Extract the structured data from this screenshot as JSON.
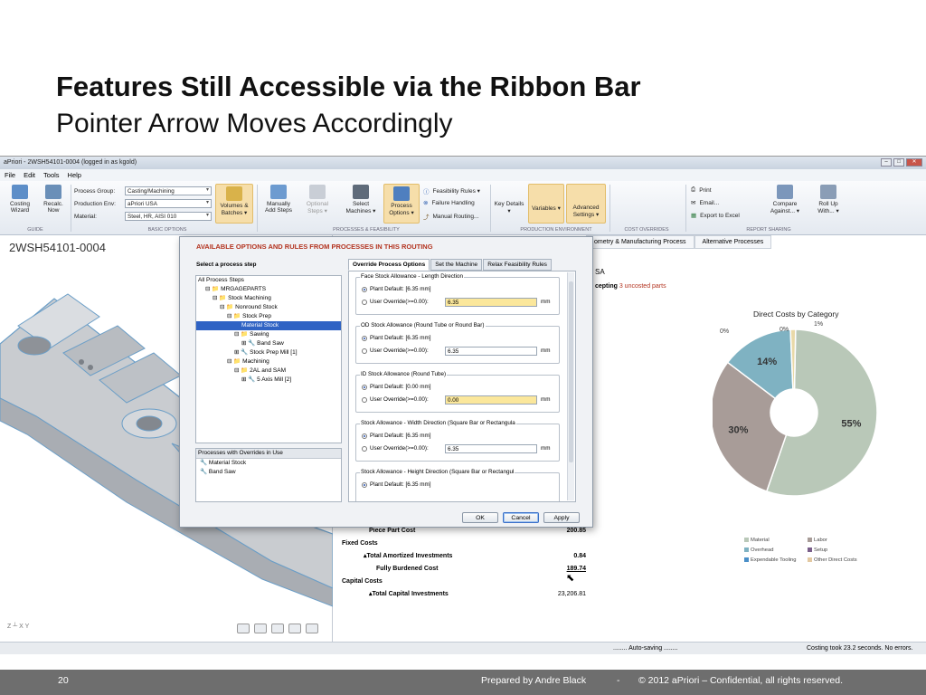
{
  "slide": {
    "title": "Features Still Accessible via the Ribbon Bar",
    "subtitle": "Pointer Arrow Moves Accordingly",
    "page_number": "20",
    "prepared_by": "Prepared by Andre Black",
    "dash": "-",
    "copyright": "© 2012 aPriori – Confidential, all rights reserved."
  },
  "window": {
    "title": "aPriori - 2WSH54101-0004 (logged in as kgold)",
    "menu": [
      "File",
      "Edit",
      "Tools",
      "Help"
    ]
  },
  "ribbon": {
    "costing_wizard": "Costing Wizard",
    "recalc": "Recalc. Now",
    "process_group_label": "Process Group:",
    "process_group_value": "Casting/Machining",
    "production_env_label": "Production Env:",
    "production_env_value": "aPriori USA",
    "material_label": "Material:",
    "material_value": "Steel, HR, AISI 010",
    "volumes_batches": "Volumes & Batches ▾",
    "manually_add_steps": "Manually Add Steps",
    "optional_steps": "Optional Steps ▾",
    "select_machines": "Select Machines ▾",
    "process_options": "Process Options ▾",
    "feasibility_rules": "Feasibility Rules ▾",
    "failure_handling": "Failure Handling",
    "manual_routing": "Manual Routing...",
    "key_details": "Key Details ▾",
    "variables": "Variables ▾",
    "advanced_settings": "Advanced Settings ▾",
    "print": "Print",
    "email": "Email...",
    "export_excel": "Export to Excel",
    "compare_against": "Compare Against... ▾",
    "roll_up_with": "Roll Up With... ▾",
    "groups": {
      "guide": "GUIDE",
      "basic": "BASIC OPTIONS",
      "process_feasibility": "PROCESSES & FEASIBILITY",
      "production_env": "PRODUCTION ENVIRONMENT",
      "cost_overrides": "COST OVERRIDES",
      "report_sharing": "REPORT SHARING"
    }
  },
  "left_pane": {
    "part_id": "2WSH54101-0004",
    "axis_label": "Z ┴ X  Y"
  },
  "right_pane": {
    "tabs": [
      "ometry & Manufacturing Process",
      "Alternative Processes"
    ],
    "sa_fragment": "SA",
    "excepting": "cepting",
    "uncosted": "3 uncosted parts",
    "chart_title": "Direct Costs by Category",
    "costs": [
      {
        "label": "Piece Part Cost",
        "value": "200.85",
        "bold": true
      },
      {
        "label": "Fixed Costs",
        "value": "",
        "bold": true
      },
      {
        "label": "▴Total Amortized Investments",
        "value": "0.84",
        "bold": true
      },
      {
        "label": "Fully Burdened Cost",
        "value": "189.74",
        "bold": true
      },
      {
        "label": "Capital Costs",
        "value": "",
        "bold": true
      },
      {
        "label": "▴Total Capital Investments",
        "value": "23,206.81",
        "bold": true
      }
    ]
  },
  "chart_data": {
    "type": "pie",
    "title": "Direct Costs by Category",
    "slices": [
      {
        "label": "Material",
        "value": 55,
        "color": "#b9c8b8"
      },
      {
        "label": "Labor",
        "value": 30,
        "color": "#a89c98"
      },
      {
        "label": "Overhead",
        "value": 14,
        "color": "#7fb2c2"
      },
      {
        "label": "Setup",
        "value": 1,
        "color": "#e9d9a8"
      },
      {
        "label": "Expendable Tooling",
        "value": 0,
        "color": "#7a5f8a"
      },
      {
        "label": "Other Direct Costs",
        "value": 0,
        "color": "#e3c9a2"
      }
    ],
    "data_labels": [
      "55%",
      "30%",
      "14%",
      "1%",
      "0%",
      "0%"
    ],
    "legend": [
      {
        "label": "Material",
        "color": "#b9c8b8"
      },
      {
        "label": "Labor",
        "color": "#a89c98"
      },
      {
        "label": "Overhead",
        "color": "#7fb2c2"
      },
      {
        "label": "Setup",
        "color": "#7a5f8a"
      },
      {
        "label": "Expendable Tooling",
        "color": "#4a8fc8"
      },
      {
        "label": "Other Direct Costs",
        "color": "#e3c9a2"
      }
    ]
  },
  "dialog": {
    "title": "AVAILABLE OPTIONS AND RULES FROM PROCESSES IN THIS ROUTING",
    "select_step": "Select a process step",
    "tree": [
      {
        "label": "All Process Steps",
        "indent": 0,
        "selected": false
      },
      {
        "label": "⊟ 📁 MRGAGEPARTS",
        "indent": 1,
        "selected": false
      },
      {
        "label": "⊟ 📁 Stock Machining",
        "indent": 2,
        "selected": false
      },
      {
        "label": "⊟ 📁 Nonround Stock",
        "indent": 3,
        "selected": false
      },
      {
        "label": "⊟ 📁 Stock Prep",
        "indent": 4,
        "selected": false
      },
      {
        "label": "Material Stock",
        "indent": 6,
        "selected": true
      },
      {
        "label": "⊟ 📁 Sawing",
        "indent": 5,
        "selected": false
      },
      {
        "label": "⊞ 🔧 Band Saw",
        "indent": 6,
        "selected": false
      },
      {
        "label": "⊞ 🔧 Stock Prep Mill [1]",
        "indent": 5,
        "selected": false
      },
      {
        "label": "⊟ 📁 Machining",
        "indent": 4,
        "selected": false
      },
      {
        "label": "⊟ 📁 2AL and SAM",
        "indent": 5,
        "selected": false
      },
      {
        "label": "⊞ 🔧 5 Axis Mill [2]",
        "indent": 6,
        "selected": false
      }
    ],
    "overrides_header": "Processes with Overrides in Use",
    "overrides": [
      "🔧 Material Stock",
      "🔧 Band Saw"
    ],
    "tabs": [
      "Override Process Options",
      "Set the Machine",
      "Relax Feasibility Rules"
    ],
    "options": [
      {
        "legend": "Face Stock Allowance - Length Direction",
        "default": "Plant Default: [6.35 mm]",
        "override": "User Override(>=0.00):",
        "value": "6.35",
        "highlight": true,
        "unit": "mm"
      },
      {
        "legend": "OD Stock Allowance (Round Tube or Round Bar)",
        "default": "Plant Default: [6.35 mm]",
        "override": "User Override(>=0.00):",
        "value": "6.35",
        "highlight": false,
        "unit": "mm"
      },
      {
        "legend": "ID Stock Allowance (Round Tube)",
        "default": "Plant Default: [0.00 mm]",
        "override": "User Override(>=0.00):",
        "value": "0.00",
        "highlight": true,
        "unit": "mm"
      },
      {
        "legend": "Stock Allowance - Width Direction (Square Bar or Rectangula",
        "default": "Plant Default: [6.35 mm]",
        "override": "User Override(>=0.00):",
        "value": "6.35",
        "highlight": false,
        "unit": "mm"
      },
      {
        "legend": "Stock Allowance - Height Direction (Square Bar or Rectangul",
        "default": "Plant Default: [6.35 mm]",
        "override": "",
        "value": "",
        "highlight": false,
        "unit": ""
      }
    ],
    "ok": "OK",
    "cancel": "Cancel",
    "apply": "Apply"
  },
  "status": {
    "autosave": "........ Auto-saving ........",
    "costing_took": "Costing took 23.2 seconds. No errors."
  }
}
